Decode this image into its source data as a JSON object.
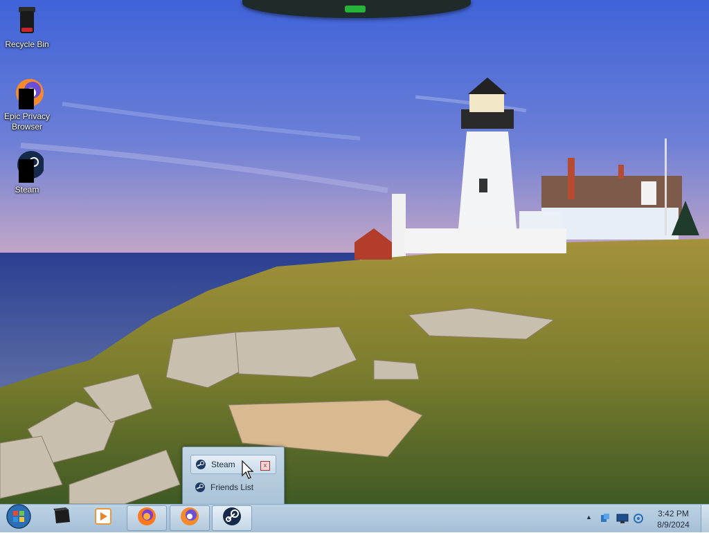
{
  "desktop": {
    "icons": [
      {
        "label": "Recycle Bin",
        "icon": "recycle-bin-icon"
      },
      {
        "label": "Epic Privacy Browser",
        "icon": "epic-browser-icon"
      },
      {
        "label": "Steam",
        "icon": "steam-icon"
      }
    ]
  },
  "jumplist": {
    "items": [
      {
        "label": "Steam",
        "icon": "steam-icon"
      },
      {
        "label": "Friends List",
        "icon": "steam-icon"
      }
    ],
    "close_label": "x"
  },
  "taskbar": {
    "start_icon": "windows-start-orb",
    "pinned": [
      "cube-icon",
      "media-player-icon",
      "firefox-icon",
      "epic-browser-icon",
      "steam-icon"
    ],
    "tray_arrow": "▲",
    "clock": {
      "time": "3:42 PM",
      "date": "8/9/2024"
    }
  },
  "colors": {
    "accent": "#27b33a",
    "taskbar": "#b3c9dc"
  }
}
